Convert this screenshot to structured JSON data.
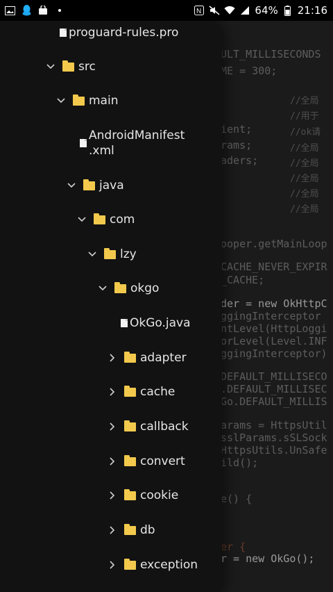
{
  "status_bar": {
    "battery": "64%",
    "time": "21:16",
    "left_icons": [
      "image-icon",
      "qq-penguin-icon",
      "bag-icon",
      "dot-icon"
    ],
    "right_icons": [
      "nfc-icon",
      "mute-icon",
      "wifi-icon",
      "cellular-icon",
      "battery-icon"
    ]
  },
  "code": {
    "lines": [
      "ULT_MILLISECONDS",
      "ME = 300;",
      "//全局",
      "//用于",
      "ient;",
      "//ok请",
      "rams;",
      "//全局",
      "aders;",
      "//全局",
      "//全局",
      "//全局",
      "//全局",
      "ooper.getMainLoop",
      "CACHE_NEVER_EXPIR",
      "_CACHE;",
      "der = new OkHttpC",
      "ggingInterceptor",
      "ntLevel(HttpLoggi",
      "orLevel(Level.INF",
      "ggingInterceptor)",
      "DEFAULT_MILLISECO",
      ".DEFAULT_MILLISEC",
      "Go.DEFAULT_MILLIS",
      "arams = HttpsUtil",
      "sslParams.sSLSock",
      "HttpsUtils.UnSafe",
      "ild();",
      "e() {",
      "er {",
      "r = new OkGo();"
    ]
  },
  "tree": {
    "items": [
      {
        "label": "proguard-rules.pro",
        "type": "file",
        "state": "none"
      },
      {
        "label": "src",
        "type": "folder",
        "state": "expanded"
      },
      {
        "label": "main",
        "type": "folder",
        "state": "expanded"
      },
      {
        "label": "AndroidManifest",
        "label2": ".xml",
        "type": "file",
        "state": "none"
      },
      {
        "label": "java",
        "type": "folder",
        "state": "expanded"
      },
      {
        "label": "com",
        "type": "folder",
        "state": "expanded"
      },
      {
        "label": "lzy",
        "type": "folder",
        "state": "expanded"
      },
      {
        "label": "okgo",
        "type": "folder",
        "state": "expanded"
      },
      {
        "label": "OkGo.java",
        "type": "file",
        "state": "none"
      },
      {
        "label": "adapter",
        "type": "folder",
        "state": "collapsed"
      },
      {
        "label": "cache",
        "type": "folder",
        "state": "collapsed"
      },
      {
        "label": "callback",
        "type": "folder",
        "state": "collapsed"
      },
      {
        "label": "convert",
        "type": "folder",
        "state": "collapsed"
      },
      {
        "label": "cookie",
        "type": "folder",
        "state": "collapsed"
      },
      {
        "label": "db",
        "type": "folder",
        "state": "collapsed"
      },
      {
        "label": "exception",
        "type": "folder",
        "state": "collapsed"
      }
    ]
  },
  "colors": {
    "folder": "#f2c94c",
    "drawer_bg": "#121212",
    "editor_bg": "#1b1b1b",
    "text": "#e6e6e6"
  }
}
